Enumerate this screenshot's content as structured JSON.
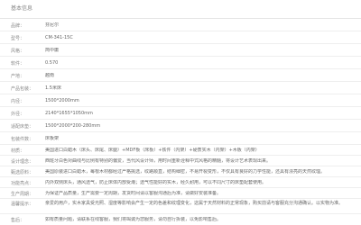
{
  "section_title": "基本信息",
  "rows": [
    {
      "label": "品牌：",
      "value": "芬尼尔"
    },
    {
      "label": "型号：",
      "value": "CM-341-15C"
    },
    {
      "label": "风格：",
      "value": "简中庸"
    },
    {
      "label": "软件：",
      "value": "0.570"
    },
    {
      "label": "产地：",
      "value": "越南"
    },
    {
      "label": "产品包装：",
      "value": "1.5米床"
    },
    {
      "label": "内径：",
      "value": "1500*2000mm"
    },
    {
      "label": "外径：",
      "value": "2140*1655*1050mm"
    },
    {
      "label": "适配床垫：",
      "value": "1500*2000*200-280mm"
    },
    {
      "label": "包装件数：",
      "value": "床板架"
    },
    {
      "label": "材质：",
      "value": "美国进口白蜡木（床头、床尾、床腿）+MDF板（床板）+铁件（内架）+硬质实木（内架）+木板（内架）"
    },
    {
      "label": "设计理念：",
      "value": "西班牙白色对曲线与比例有特别的偏爱，当代风设计师，用时间重新诠释中式风格的精髓，将设计艺术表现出来。"
    },
    {
      "label": "甄选原料：",
      "value": "美国原装进口白蜡木，每根木材都经过严格挑选，纹路顺直，结构细密，不易开裂变形，不仅具有良好的力学性能，还具有漂亮的天然纹理。"
    },
    {
      "label": "功能亮点：",
      "value": "内外双侧床头，通风透气，防止床体内部受潮；透气性能好的实木，经久耐用，可以不同尺寸的床垫配套使用。"
    },
    {
      "label": "生产周期：",
      "value": "为保证产品质量，生产需要一定周期，发货时间请以客服沟通后为准，请做好安装准备。"
    },
    {
      "label": "温馨提示：",
      "value": "亲爱的用户，实木家具受光照、湿度等影响会产生一定的色差和纹理变化，这属于天然材料的正常现象，购买前请与客服充分沟通确认。以实物为准。"
    },
    {
      "label": "售后：",
      "value": "如有质量问题，请联系在线客服，我们将竭诚为您服务，请勿自行拆装，以免影响售后。"
    }
  ]
}
